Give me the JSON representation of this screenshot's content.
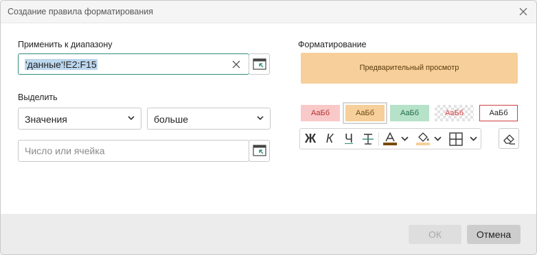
{
  "dialog": {
    "title": "Создание правила форматирования"
  },
  "apply_range": {
    "label": "Применить к диапазону",
    "value": "'данные'!E2:F15"
  },
  "highlight": {
    "label": "Выделить",
    "type_select": "Значения",
    "condition_select": "больше",
    "value_placeholder": "Число или ячейка"
  },
  "formatting": {
    "label": "Форматирование",
    "preview_text": "Предварительный просмотр",
    "presets": [
      "АаБб",
      "АаБб",
      "АаБб",
      "АаБб",
      "АаБб"
    ],
    "font_color": "#7a4a00",
    "fill_color": "#f6cf9a"
  },
  "toolbar": {
    "bold": "Ж",
    "italic": "К",
    "underline": "Ч"
  },
  "footer": {
    "ok_label": "ОК",
    "cancel_label": "Отмена"
  }
}
